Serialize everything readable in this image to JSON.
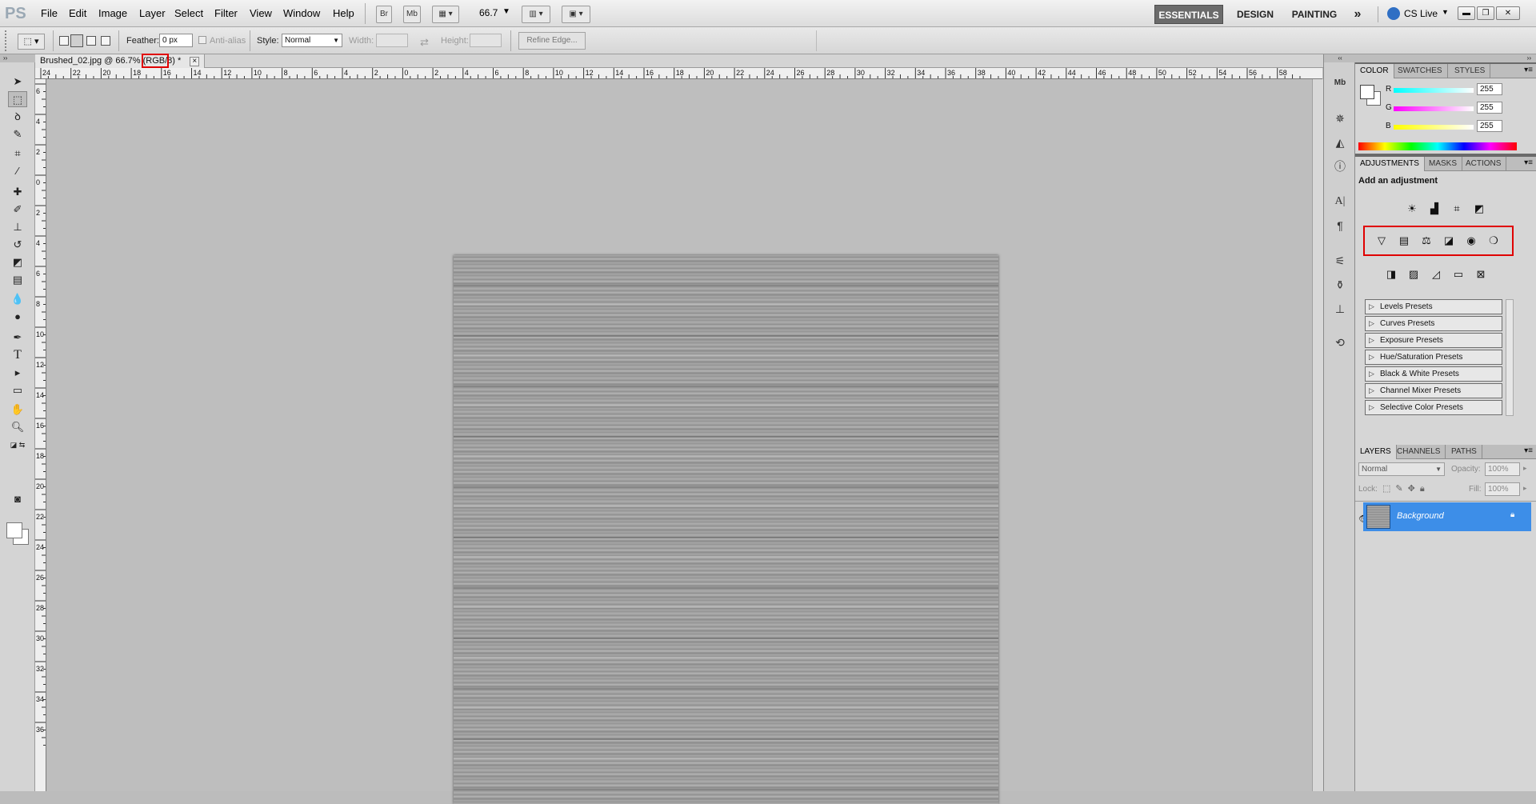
{
  "app": {
    "logo": "PS",
    "zoom": "66.7"
  },
  "menu": [
    "File",
    "Edit",
    "Image",
    "Layer",
    "Select",
    "Filter",
    "View",
    "Window",
    "Help"
  ],
  "toolbar_buttons": {
    "bridge": "Br",
    "mini_bridge": "Mb"
  },
  "workspaces": {
    "essentials": "ESSENTIALS",
    "design": "DESIGN",
    "painting": "PAINTING",
    "more": "»",
    "cslive": "CS Live"
  },
  "options": {
    "feather_label": "Feather:",
    "feather_value": "0 px",
    "antialias_label": "Anti-alias",
    "style_label": "Style:",
    "style_value": "Normal",
    "width_label": "Width:",
    "height_label": "Height:",
    "refine_label": "Refine Edge..."
  },
  "document": {
    "tab_title": "Brushed_02.jpg @ 66.7% (RGB/8) *",
    "close": "×"
  },
  "ruler_top": [
    "24",
    "22",
    "20",
    "18",
    "16",
    "14",
    "12",
    "10",
    "8",
    "6",
    "4",
    "2",
    "0",
    "2",
    "4",
    "6",
    "8",
    "10",
    "12",
    "14",
    "16",
    "18",
    "20",
    "22",
    "24",
    "26",
    "28",
    "30",
    "32",
    "34",
    "36",
    "38",
    "40",
    "42",
    "44",
    "46",
    "48",
    "50",
    "52",
    "54",
    "56",
    "58"
  ],
  "ruler_left": [
    "6",
    "4",
    "2",
    "0",
    "2",
    "4",
    "6",
    "8",
    "10",
    "12",
    "14",
    "16",
    "18",
    "20",
    "22",
    "24",
    "26",
    "28",
    "30",
    "32",
    "34",
    "36"
  ],
  "color_panel": {
    "tabs": [
      "COLOR",
      "SWATCHES",
      "STYLES"
    ],
    "r_label": "R",
    "g_label": "G",
    "b_label": "B",
    "r": "255",
    "g": "255",
    "b": "255"
  },
  "adjustments_panel": {
    "tabs": [
      "ADJUSTMENTS",
      "MASKS",
      "ACTIONS"
    ],
    "heading": "Add an adjustment",
    "presets": [
      "Levels Presets",
      "Curves Presets",
      "Exposure Presets",
      "Hue/Saturation Presets",
      "Black & White Presets",
      "Channel Mixer Presets",
      "Selective Color Presets"
    ]
  },
  "layers_panel": {
    "tabs": [
      "LAYERS",
      "CHANNELS",
      "PATHS"
    ],
    "blend": "Normal",
    "opacity_label": "Opacity:",
    "opacity": "100%",
    "lock_label": "Lock:",
    "fill_label": "Fill:",
    "fill": "100%",
    "layers": [
      {
        "name": "Background"
      }
    ]
  },
  "colors": {
    "accent": "#3d8ee8",
    "highlight": "#e00000"
  }
}
